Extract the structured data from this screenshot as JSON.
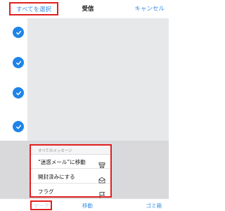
{
  "topbar": {
    "select_all_label": "すべてを選択",
    "title": "受信",
    "cancel_label": "キャンセル"
  },
  "list": {
    "selected_count": 4
  },
  "sheet": {
    "title": "すべてのメッセージ",
    "actions": [
      {
        "label": "“迷惑メール”に移動",
        "icon": "junk-icon"
      },
      {
        "label": "開封済みにする",
        "icon": "envelope-open-icon"
      },
      {
        "label": "フラグ",
        "icon": "flag-icon"
      }
    ]
  },
  "toolbar": {
    "flag_label": "マーク",
    "move_label": "移動",
    "trash_label": "ゴミ箱"
  },
  "colors": {
    "accent": "#1e84e8",
    "highlight": "#e02020"
  }
}
